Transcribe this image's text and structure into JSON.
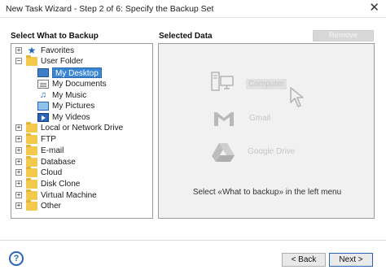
{
  "window": {
    "title": "New Task Wizard - Step 2 of 6: Specify the Backup Set",
    "close_glyph": "✕"
  },
  "left_panel": {
    "label": "Select What to Backup",
    "tree": [
      {
        "label": "Favorites",
        "icon": "star-icon",
        "expander": "+"
      },
      {
        "label": "User Folder",
        "icon": "folder-icon",
        "expander": "−"
      },
      {
        "label": "My Desktop",
        "icon": "desktop-icon",
        "selected": true
      },
      {
        "label": "My Documents",
        "icon": "documents-icon"
      },
      {
        "label": "My Music",
        "icon": "music-icon"
      },
      {
        "label": "My Pictures",
        "icon": "pictures-icon"
      },
      {
        "label": "My Videos",
        "icon": "videos-icon"
      },
      {
        "label": "Local or Network Drive",
        "icon": "folder-icon",
        "expander": "+"
      },
      {
        "label": "FTP",
        "icon": "folder-icon",
        "expander": "+"
      },
      {
        "label": "E-mail",
        "icon": "folder-icon",
        "expander": "+"
      },
      {
        "label": "Database",
        "icon": "folder-icon",
        "expander": "+"
      },
      {
        "label": "Cloud",
        "icon": "folder-icon",
        "expander": "+"
      },
      {
        "label": "Disk Clone",
        "icon": "folder-icon",
        "expander": "+"
      },
      {
        "label": "Virtual Machine",
        "icon": "folder-icon",
        "expander": "+"
      },
      {
        "label": "Other",
        "icon": "folder-icon",
        "expander": "+"
      }
    ]
  },
  "right_panel": {
    "label": "Selected Data",
    "remove_label": "Remove",
    "sources": [
      {
        "label": "Computer",
        "icon": "computer-icon"
      },
      {
        "label": "Gmail",
        "icon": "gmail-icon"
      },
      {
        "label": "Google Drive",
        "icon": "google-drive-icon"
      }
    ],
    "hint": "Select «What to backup» in the left menu"
  },
  "footer": {
    "help_glyph": "?",
    "back_label": "< Back",
    "next_label": "Next >"
  },
  "colors": {
    "accent": "#3b86d4",
    "help_blue": "#2a64b8",
    "folder_yellow": "#f2c94c",
    "disabled_text": "#c6c6c6"
  }
}
